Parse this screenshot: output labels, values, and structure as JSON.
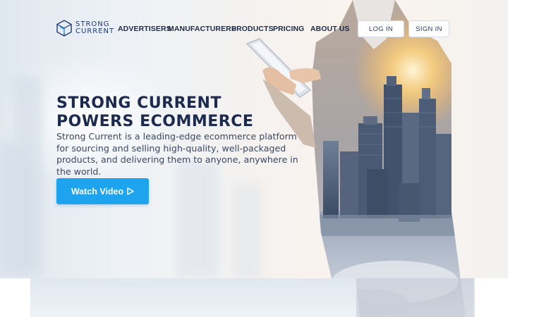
{
  "brand": {
    "line1": "STRONG",
    "line2": "CURRENT"
  },
  "nav": {
    "items": [
      {
        "label": "ADVERTISERS"
      },
      {
        "label": "MANUFACTURERS"
      },
      {
        "label": "PRODUCTS"
      },
      {
        "label": "PRICING"
      },
      {
        "label": "ABOUT US"
      }
    ],
    "login_label": "LOG IN",
    "signin_label": "SIGN IN"
  },
  "hero": {
    "headline_line1": "STRONG CURRENT",
    "headline_line2": "POWERS ECOMMERCE",
    "subtext": "Strong Current is a leading-edge ecommerce platform for sourcing and selling high-quality, well-packaged products, and delivering them to anyone, anywhere in the world.",
    "cta_label": "Watch Video"
  },
  "colors": {
    "accent": "#1ea3ee",
    "heading": "#1c2a4e",
    "brand": "#1e3a78"
  },
  "icons": {
    "logo": "cube-logo-icon",
    "cta": "play-triangle-icon"
  }
}
